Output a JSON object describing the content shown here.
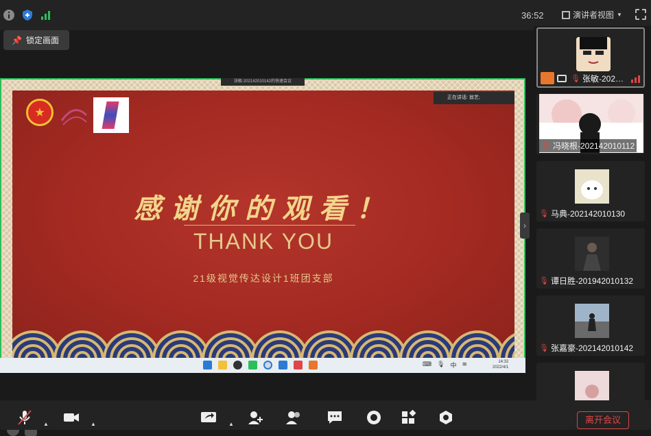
{
  "top": {
    "time": "36:52",
    "speaker_view": "演讲者视图",
    "lock_screen": "锁定画面"
  },
  "share": {
    "bar_text": "张敏-202142010142的快速会议",
    "speaking": "正在讲话: 翁艺;",
    "slide": {
      "title_cn": "感谢你的观看！",
      "title_en": "THANK YOU",
      "subtitle": "21级视觉传达设计1班团支部"
    },
    "taskbar_tray": "中",
    "taskbar_time": "14:32",
    "taskbar_date": "2022/4/1"
  },
  "participants": [
    {
      "name": "张敏-202…",
      "avatar_color": "#f0e0c8"
    },
    {
      "name": "冯晓根-202142010112",
      "avatar_color": "#f6dede"
    },
    {
      "name": "马典-202142010130",
      "avatar_color": "#f2ecd8"
    },
    {
      "name": "谭日胜-201942010132",
      "avatar_color": "#3a3a3a"
    },
    {
      "name": "张嘉豪-202142010142",
      "avatar_color": "#8aa0b8"
    },
    {
      "name": "",
      "avatar_color": "#e9d6d6"
    }
  ],
  "bottom": {
    "leave": "离开会议"
  },
  "colors": {
    "accent_green": "#2bbf5a",
    "danger_red": "#e04646",
    "slide_red": "#a32a22",
    "gold": "#e6c98d"
  }
}
